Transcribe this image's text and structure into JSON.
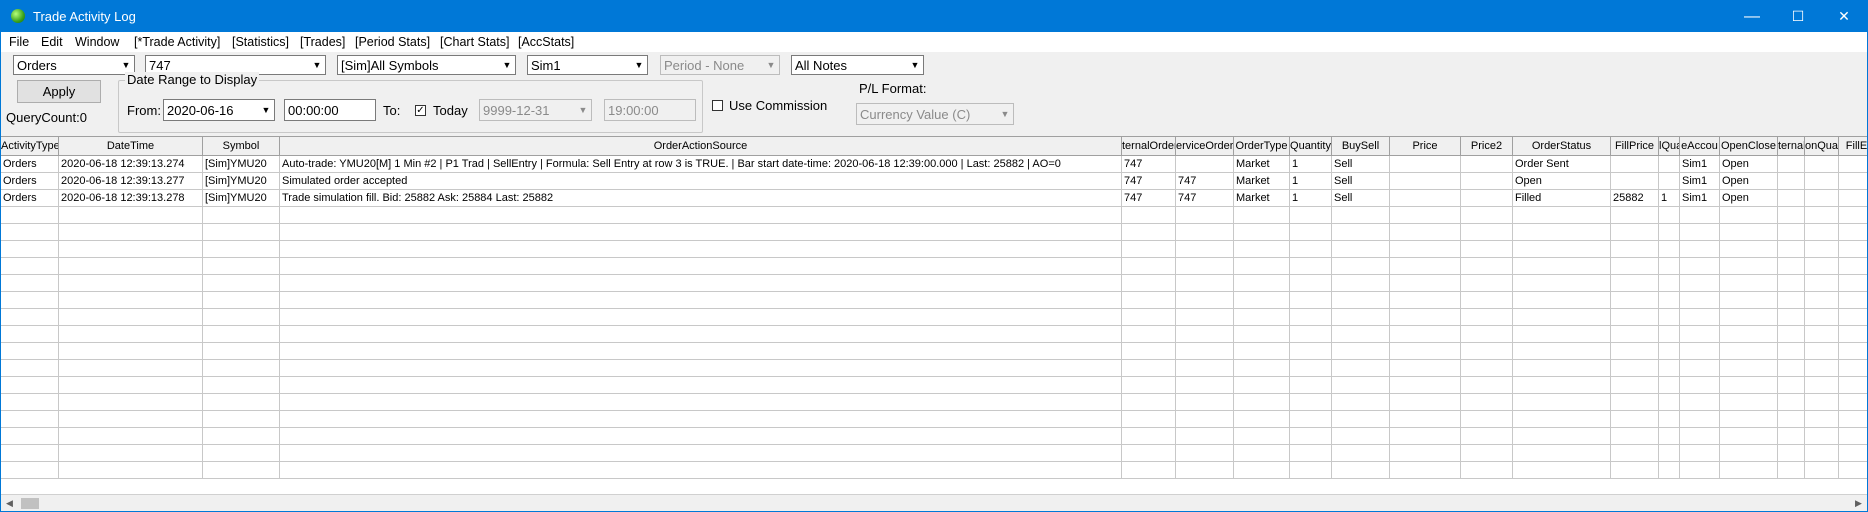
{
  "window": {
    "title": "Trade Activity Log",
    "minimize": "—",
    "maximize": "☐",
    "close": "✕"
  },
  "menu": [
    "File",
    "Edit",
    "Window",
    "[*Trade Activity]",
    "[Statistics]",
    "[Trades]",
    "[Period Stats]",
    "[Chart Stats]",
    "[AccStats]"
  ],
  "toolbar": {
    "activity_type": "Orders",
    "account_id": "747",
    "symbols": "[Sim]All Symbols",
    "trade_account": "Sim1",
    "period": "Period - None",
    "notes": "All Notes",
    "apply": "Apply",
    "query_count": "QueryCount:0",
    "date_range_legend": "Date Range to Display",
    "from_label": "From:",
    "from_date": "2020-06-16",
    "from_time": "00:00:00",
    "to_label": "To:",
    "today_label": "Today",
    "today_checked": "✓",
    "to_date": "9999-12-31",
    "to_time": "19:00:00",
    "use_commission": "Use Commission",
    "pl_format_label": "P/L Format:",
    "pl_format": "Currency Value (C)"
  },
  "grid": {
    "columns": [
      "ActivityType",
      "DateTime",
      "Symbol",
      "OrderActionSource",
      "InternalOrderID",
      "ServiceOrderID",
      "OrderType",
      "Quantity",
      "BuySell",
      "Price",
      "Price2",
      "OrderStatus",
      "FillPrice",
      "FilledQuantity",
      "TradeAccount",
      "OpenClose",
      "ParentInternalOrderID",
      "PositionQuantity",
      "FillExecutionServiceID"
    ],
    "column_labels": [
      "ActivityType",
      "DateTime",
      "Symbol",
      "OrderActionSource",
      "ternalOrder",
      "erviceOrderI",
      "OrderType",
      "Quantity",
      "BuySell",
      "Price",
      "Price2",
      "OrderStatus",
      "FillPrice",
      "lQuantit",
      "eAccou",
      "OpenClose",
      "ternalOr",
      "onQua",
      "FillE"
    ],
    "rows": [
      [
        "Orders",
        "2020-06-18  12:39:13.274",
        "[Sim]YMU20",
        "Auto-trade: YMU20[M]  1 Min   #2 | P1 Trad | SellEntry | Formula: Sell Entry at row 3 is TRUE. | Bar start date-time: 2020-06-18  12:39:00.000 | Last: 25882 | AO=0",
        "747",
        "",
        "Market",
        "1",
        "Sell",
        "",
        "",
        "Order Sent",
        "",
        "",
        "Sim1",
        "Open",
        "",
        "",
        ""
      ],
      [
        "Orders",
        "2020-06-18  12:39:13.277",
        "[Sim]YMU20",
        "Simulated order accepted",
        "747",
        "747",
        "Market",
        "1",
        "Sell",
        "",
        "",
        "Open",
        "",
        "",
        "Sim1",
        "Open",
        "",
        "",
        ""
      ],
      [
        "Orders",
        "2020-06-18  12:39:13.278",
        "[Sim]YMU20",
        "Trade simulation fill. Bid: 25882 Ask: 25884 Last: 25882",
        "747",
        "747",
        "Market",
        "1",
        "Sell",
        "",
        "",
        "Filled",
        "25882",
        "1",
        "Sim1",
        "Open",
        "",
        "",
        ""
      ]
    ]
  }
}
